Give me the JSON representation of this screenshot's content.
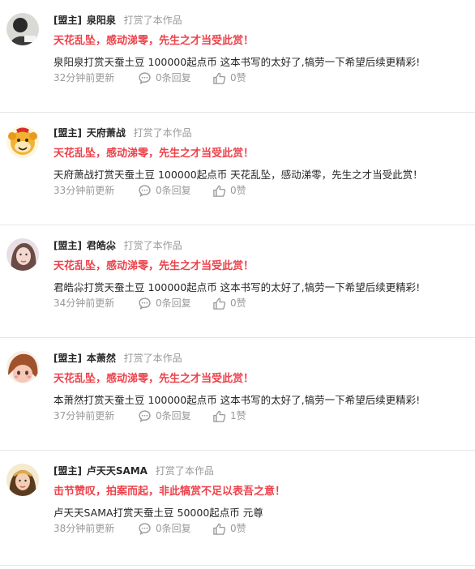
{
  "comments": [
    {
      "tag": "[盟主]",
      "name": "泉阳泉",
      "action": "打赏了本作品",
      "headline": "天花乱坠，感动涕零，先生之才当受此赏！",
      "text": "泉阳泉打赏天蚕土豆 100000起点币 这本书写的太好了,犒劳一下希望后续更精彩!",
      "time": "32分钟前更新",
      "replies": "0条回复",
      "likes": "0赞"
    },
    {
      "tag": "[盟主]",
      "name": "天府萧战",
      "action": "打赏了本作品",
      "headline": "天花乱坠，感动涕零，先生之才当受此赏！",
      "text": "天府萧战打赏天蚕土豆 100000起点币 天花乱坠，感动涕零，先生之才当受此赏！",
      "time": "33分钟前更新",
      "replies": "0条回复",
      "likes": "0赞"
    },
    {
      "tag": "[盟主]",
      "name": "君皓尛",
      "action": "打赏了本作品",
      "headline": "天花乱坠，感动涕零，先生之才当受此赏！",
      "text": "君皓尛打赏天蚕土豆 100000起点币 这本书写的太好了,犒劳一下希望后续更精彩!",
      "time": "34分钟前更新",
      "replies": "0条回复",
      "likes": "0赞"
    },
    {
      "tag": "[盟主]",
      "name": "本萧然",
      "action": "打赏了本作品",
      "headline": "天花乱坠，感动涕零，先生之才当受此赏！",
      "text": "本萧然打赏天蚕土豆 100000起点币 这本书写的太好了,犒劳一下希望后续更精彩!",
      "time": "37分钟前更新",
      "replies": "0条回复",
      "likes": "1赞"
    },
    {
      "tag": "[盟主]",
      "name": "卢天天SAMA",
      "action": "打赏了本作品",
      "headline": "击节赞叹，拍案而起，非此犒赏不足以表吾之意！",
      "text": "卢天天SAMA打赏天蚕土豆 50000起点币 元尊",
      "time": "38分钟前更新",
      "replies": "0条回复",
      "likes": "0赞"
    }
  ],
  "colors": {
    "headline": "#ed424b",
    "meta_gray": "#999999",
    "divider": "#e6e6e6"
  },
  "icons": {
    "reply": "speech-bubble-icon",
    "like": "thumbs-up-icon"
  }
}
